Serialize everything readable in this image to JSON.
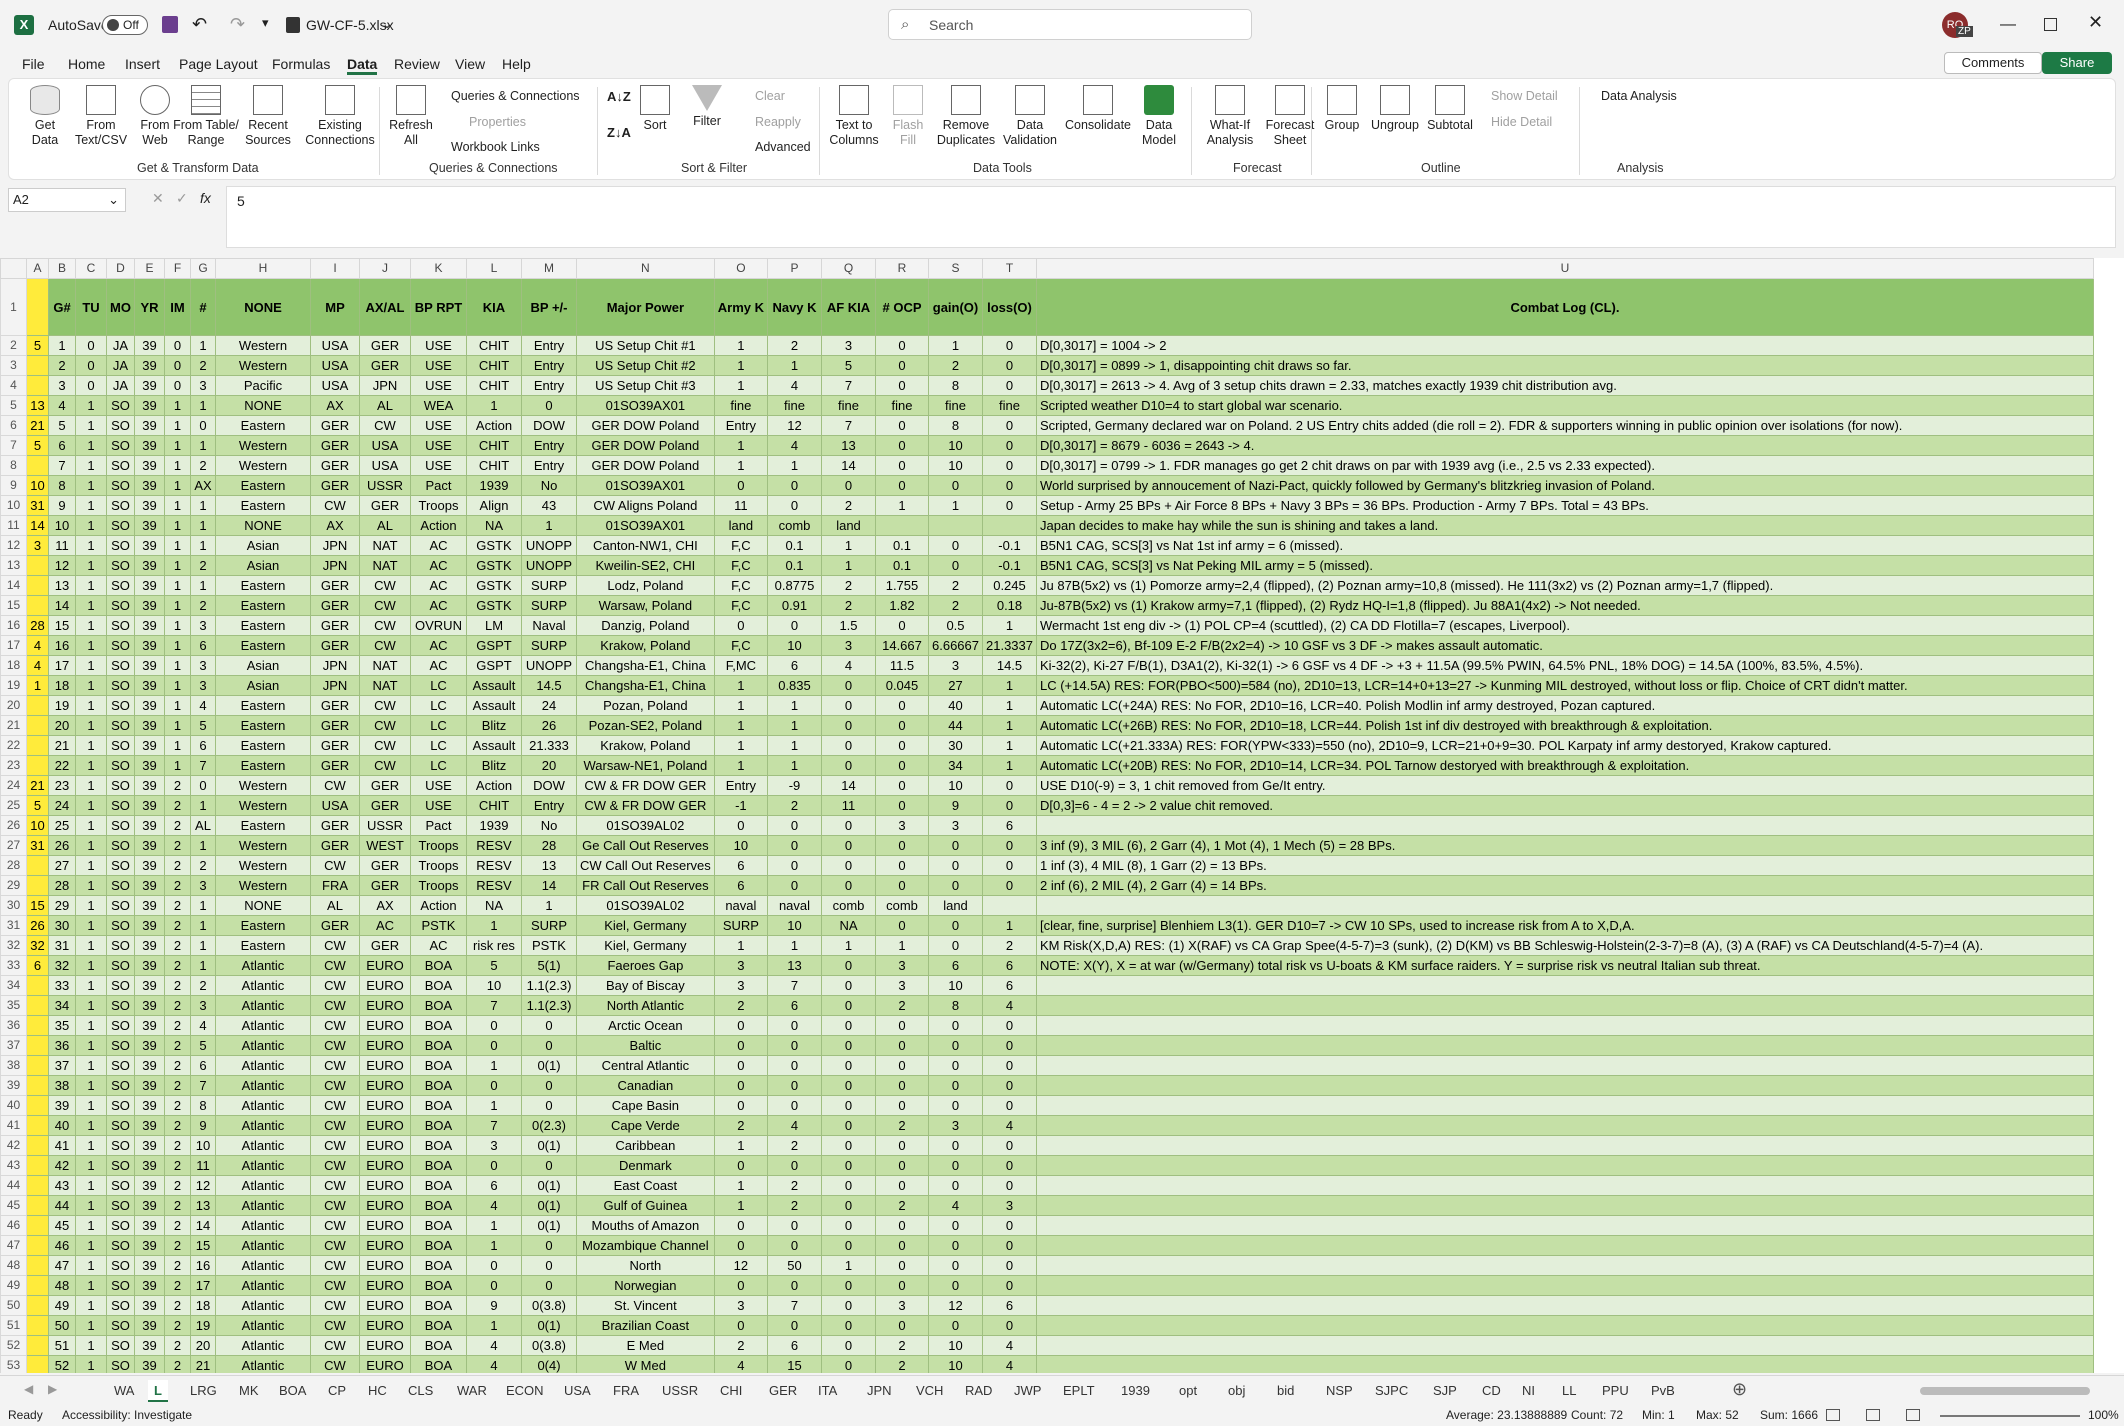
{
  "app": {
    "autosave_label": "AutoSave",
    "autosave_state": "Off",
    "file_name": "GW-CF-5.xlsx",
    "search_placeholder": "Search",
    "user_initials": "RO",
    "keytip_zp": "ZP"
  },
  "menu": [
    "File",
    "Home",
    "Insert",
    "Page Layout",
    "Formulas",
    "Data",
    "Review",
    "View",
    "Help"
  ],
  "comments_label": "Comments",
  "share_label": "Share",
  "ribbon": {
    "get_transform": {
      "group": "Get & Transform Data",
      "buttons": [
        "Get\nData",
        "From\nText/CSV",
        "From\nWeb",
        "From Table/\nRange",
        "Recent\nSources",
        "Existing\nConnections"
      ]
    },
    "queries": {
      "group": "Queries & Connections",
      "refresh": "Refresh\nAll",
      "items": [
        "Queries & Connections",
        "Properties",
        "Workbook Links"
      ]
    },
    "sort_filter": {
      "group": "Sort & Filter",
      "sort": "Sort",
      "filter": "Filter",
      "clear": "Clear",
      "reapply": "Reapply",
      "advanced": "Advanced"
    },
    "data_tools": {
      "group": "Data Tools",
      "buttons": [
        "Text to\nColumns",
        "Flash\nFill",
        "Remove\nDuplicates",
        "Data\nValidation",
        "Consolidate",
        "Data\nModel"
      ]
    },
    "forecast": {
      "group": "Forecast",
      "buttons": [
        "What-If\nAnalysis",
        "Forecast\nSheet"
      ]
    },
    "outline": {
      "group": "Outline",
      "buttons": [
        "Group",
        "Ungroup",
        "Subtotal"
      ],
      "show": "Show Detail",
      "hide": "Hide Detail"
    },
    "analysis": {
      "group": "Analysis",
      "data_analysis": "Data Analysis"
    }
  },
  "formula": {
    "namebox": "A2",
    "fx": "fx",
    "value": "5"
  },
  "columns": [
    "A",
    "B",
    "C",
    "D",
    "E",
    "F",
    "G",
    "H",
    "I",
    "J",
    "K",
    "L",
    "M",
    "N",
    "O",
    "P",
    "Q",
    "R",
    "S",
    "T",
    "U"
  ],
  "header_row": [
    "",
    "G#",
    "TU",
    "MO",
    "YR",
    "IM",
    "#",
    "NONE",
    "MP",
    "AX/AL",
    "BP RPT",
    "KIA",
    "BP +/-",
    "Major Power",
    "Army K",
    "Navy K",
    "AF KIA",
    "# OCP",
    "gain(O)",
    "loss(O)",
    "Combat Log (CL)."
  ],
  "rows": [
    [
      "5",
      "1",
      "0",
      "JA",
      "39",
      "0",
      "1",
      "Western",
      "USA",
      "GER",
      "USE",
      "CHIT",
      "Entry",
      "US Setup Chit #1",
      "1",
      "2",
      "3",
      "0",
      "1",
      "0",
      "D[0,3017] = 1004 -> 2"
    ],
    [
      "",
      "2",
      "0",
      "JA",
      "39",
      "0",
      "2",
      "Western",
      "USA",
      "GER",
      "USE",
      "CHIT",
      "Entry",
      "US Setup Chit #2",
      "1",
      "1",
      "5",
      "0",
      "2",
      "0",
      "D[0,3017] = 0899 -> 1, disappointing chit draws so far."
    ],
    [
      "",
      "3",
      "0",
      "JA",
      "39",
      "0",
      "3",
      "Pacific",
      "USA",
      "JPN",
      "USE",
      "CHIT",
      "Entry",
      "US Setup Chit #3",
      "1",
      "4",
      "7",
      "0",
      "8",
      "0",
      "D[0,3017] = 2613 -> 4.  Avg of 3 setup chits drawn = 2.33, matches exactly 1939 chit distribution avg."
    ],
    [
      "13",
      "4",
      "1",
      "SO",
      "39",
      "1",
      "1",
      "NONE",
      "AX",
      "AL",
      "WEA",
      "1",
      "0",
      "01SO39AX01",
      "fine",
      "fine",
      "fine",
      "fine",
      "fine",
      "fine",
      "Scripted weather D10=4 to start global war scenario."
    ],
    [
      "21",
      "5",
      "1",
      "SO",
      "39",
      "1",
      "0",
      "Eastern",
      "GER",
      "CW",
      "USE",
      "Action",
      "DOW",
      "GER DOW Poland",
      "Entry",
      "12",
      "7",
      "0",
      "8",
      "0",
      "Scripted, Germany declared war on Poland.  2 US Entry chits added (die roll = 2).  FDR & supporters winning in public opinion over isolations (for now)."
    ],
    [
      "5",
      "6",
      "1",
      "SO",
      "39",
      "1",
      "1",
      "Western",
      "GER",
      "USA",
      "USE",
      "CHIT",
      "Entry",
      "GER DOW Poland",
      "1",
      "4",
      "13",
      "0",
      "10",
      "0",
      "D[0,3017] = 8679 - 6036 = 2643 -> 4."
    ],
    [
      "",
      "7",
      "1",
      "SO",
      "39",
      "1",
      "2",
      "Western",
      "GER",
      "USA",
      "USE",
      "CHIT",
      "Entry",
      "GER DOW Poland",
      "1",
      "1",
      "14",
      "0",
      "10",
      "0",
      "D[0,3017] = 0799 -> 1.  FDR manages go get 2 chit draws on par with 1939 avg (i.e., 2.5 vs 2.33 expected)."
    ],
    [
      "10",
      "8",
      "1",
      "SO",
      "39",
      "1",
      "AX",
      "Eastern",
      "GER",
      "USSR",
      "Pact",
      "1939",
      "No",
      "01SO39AX01",
      "0",
      "0",
      "0",
      "0",
      "0",
      "0",
      "World surprised by annoucement of Nazi-Pact, quickly followed by Germany's blitzkrieg invasion of Poland."
    ],
    [
      "31",
      "9",
      "1",
      "SO",
      "39",
      "1",
      "1",
      "Eastern",
      "CW",
      "GER",
      "Troops",
      "Align",
      "43",
      "CW Aligns Poland",
      "11",
      "0",
      "2",
      "1",
      "1",
      "0",
      "Setup - Army 25 BPs + Air Force 8 BPs + Navy 3 BPs = 36 BPs.  Production - Army 7 BPs.  Total = 43 BPs."
    ],
    [
      "14",
      "10",
      "1",
      "SO",
      "39",
      "1",
      "1",
      "NONE",
      "AX",
      "AL",
      "Action",
      "NA",
      "1",
      "01SO39AX01",
      "land",
      "comb",
      "land",
      "",
      "",
      "",
      "Japan decides to make hay while the sun is shining and takes a land."
    ],
    [
      "3",
      "11",
      "1",
      "SO",
      "39",
      "1",
      "1",
      "Asian",
      "JPN",
      "NAT",
      "AC",
      "GSTK",
      "UNOPP",
      "Canton-NW1, CHI",
      "F,C",
      "0.1",
      "1",
      "0.1",
      "0",
      "-0.1",
      "B5N1 CAG, SCS[3] vs Nat 1st inf army = 6 (missed)."
    ],
    [
      "",
      "12",
      "1",
      "SO",
      "39",
      "1",
      "2",
      "Asian",
      "JPN",
      "NAT",
      "AC",
      "GSTK",
      "UNOPP",
      "Kweilin-SE2, CHI",
      "F,C",
      "0.1",
      "1",
      "0.1",
      "0",
      "-0.1",
      "B5N1 CAG, SCS[3] vs Nat Peking MIL army = 5 (missed)."
    ],
    [
      "",
      "13",
      "1",
      "SO",
      "39",
      "1",
      "1",
      "Eastern",
      "GER",
      "CW",
      "AC",
      "GSTK",
      "SURP",
      "Lodz, Poland",
      "F,C",
      "0.8775",
      "2",
      "1.755",
      "2",
      "0.245",
      "Ju 87B(5x2) vs (1) Pomorze army=2,4 (flipped), (2) Poznan army=10,8 (missed).  He 111(3x2) vs (2) Poznan army=1,7 (flipped)."
    ],
    [
      "",
      "14",
      "1",
      "SO",
      "39",
      "1",
      "2",
      "Eastern",
      "GER",
      "CW",
      "AC",
      "GSTK",
      "SURP",
      "Warsaw, Poland",
      "F,C",
      "0.91",
      "2",
      "1.82",
      "2",
      "0.18",
      "Ju-87B(5x2) vs (1) Krakow army=7,1 (flipped), (2) Rydz HQ-I=1,8 (flipped).  Ju 88A1(4x2) -> Not needed."
    ],
    [
      "28",
      "15",
      "1",
      "SO",
      "39",
      "1",
      "3",
      "Eastern",
      "GER",
      "CW",
      "OVRUN",
      "LM",
      "Naval",
      "Danzig, Poland",
      "0",
      "0",
      "1.5",
      "0",
      "0.5",
      "1",
      "Wermacht 1st eng div -> (1) POL CP=4 (scuttled), (2) CA DD Flotilla=7 (escapes, Liverpool)."
    ],
    [
      "4",
      "16",
      "1",
      "SO",
      "39",
      "1",
      "6",
      "Eastern",
      "GER",
      "CW",
      "AC",
      "GSPT",
      "SURP",
      "Krakow, Poland",
      "F,C",
      "10",
      "3",
      "14.667",
      "6.66667",
      "21.3337",
      "Do 17Z(3x2=6), Bf-109 E-2 F/B(2x2=4) -> 10 GSF vs 3 DF -> makes assault automatic."
    ],
    [
      "4",
      "17",
      "1",
      "SO",
      "39",
      "1",
      "3",
      "Asian",
      "JPN",
      "NAT",
      "AC",
      "GSPT",
      "UNOPP",
      "Changsha-E1, China",
      "F,MC",
      "6",
      "4",
      "11.5",
      "3",
      "14.5",
      "Ki-32(2), Ki-27 F/B(1), D3A1(2), Ki-32(1) -> 6 GSF vs 4 DF -> +3 + 11.5A (99.5% PWIN, 64.5% PNL, 18% DOG) = 14.5A (100%, 83.5%, 4.5%)."
    ],
    [
      "1",
      "18",
      "1",
      "SO",
      "39",
      "1",
      "3",
      "Asian",
      "JPN",
      "NAT",
      "LC",
      "Assault",
      "14.5",
      "Changsha-E1, China",
      "1",
      "0.835",
      "0",
      "0.045",
      "27",
      "1",
      "LC (+14.5A) RES:  FOR(PBO<500)=584 (no), 2D10=13, LCR=14+0+13=27 -> Kunming MIL destroyed, without loss or flip.  Choice of CRT didn't matter."
    ],
    [
      "",
      "19",
      "1",
      "SO",
      "39",
      "1",
      "4",
      "Eastern",
      "GER",
      "CW",
      "LC",
      "Assault",
      "24",
      "Pozan, Poland",
      "1",
      "1",
      "0",
      "0",
      "40",
      "1",
      "Automatic LC(+24A) RES:  No FOR, 2D10=16, LCR=40.  Polish Modlin inf army destroyed, Pozan captured."
    ],
    [
      "",
      "20",
      "1",
      "SO",
      "39",
      "1",
      "5",
      "Eastern",
      "GER",
      "CW",
      "LC",
      "Blitz",
      "26",
      "Pozan-SE2, Poland",
      "1",
      "1",
      "0",
      "0",
      "44",
      "1",
      "Automatic LC(+26B) RES:  No FOR, 2D10=18, LCR=44.  Polish 1st inf div destroyed with breakthrough & exploitation."
    ],
    [
      "",
      "21",
      "1",
      "SO",
      "39",
      "1",
      "6",
      "Eastern",
      "GER",
      "CW",
      "LC",
      "Assault",
      "21.333",
      "Krakow, Poland",
      "1",
      "1",
      "0",
      "0",
      "30",
      "1",
      "Automatic LC(+21.333A) RES:  FOR(YPW<333)=550 (no), 2D10=9, LCR=21+0+9=30.  POL Karpaty inf army destoryed, Krakow captured."
    ],
    [
      "",
      "22",
      "1",
      "SO",
      "39",
      "1",
      "7",
      "Eastern",
      "GER",
      "CW",
      "LC",
      "Blitz",
      "20",
      "Warsaw-NE1, Poland",
      "1",
      "1",
      "0",
      "0",
      "34",
      "1",
      "Automatic LC(+20B) RES:  No FOR, 2D10=14, LCR=34.  POL Tarnow destoryed with breakthrough & exploitation."
    ],
    [
      "21",
      "23",
      "1",
      "SO",
      "39",
      "2",
      "0",
      "Western",
      "CW",
      "GER",
      "USE",
      "Action",
      "DOW",
      "CW & FR DOW GER",
      "Entry",
      "-9",
      "14",
      "0",
      "10",
      "0",
      "USE D10(-9) = 3, 1 chit removed from Ge/It entry."
    ],
    [
      "5",
      "24",
      "1",
      "SO",
      "39",
      "2",
      "1",
      "Western",
      "USA",
      "GER",
      "USE",
      "CHIT",
      "Entry",
      "CW & FR DOW GER",
      "-1",
      "2",
      "11",
      "0",
      "9",
      "0",
      "D[0,3]=6 - 4 = 2 -> 2 value chit removed."
    ],
    [
      "10",
      "25",
      "1",
      "SO",
      "39",
      "2",
      "AL",
      "Eastern",
      "GER",
      "USSR",
      "Pact",
      "1939",
      "No",
      "01SO39AL02",
      "0",
      "0",
      "0",
      "3",
      "3",
      "6",
      ""
    ],
    [
      "31",
      "26",
      "1",
      "SO",
      "39",
      "2",
      "1",
      "Western",
      "GER",
      "WEST",
      "Troops",
      "RESV",
      "28",
      "Ge Call Out Reserves",
      "10",
      "0",
      "0",
      "0",
      "0",
      "0",
      "3 inf (9), 3 MIL (6), 2 Garr (4), 1 Mot (4), 1 Mech (5) = 28 BPs."
    ],
    [
      "",
      "27",
      "1",
      "SO",
      "39",
      "2",
      "2",
      "Western",
      "CW",
      "GER",
      "Troops",
      "RESV",
      "13",
      "CW Call Out Reserves",
      "6",
      "0",
      "0",
      "0",
      "0",
      "0",
      "1 inf (3), 4 MIL (8), 1 Garr (2) = 13 BPs."
    ],
    [
      "",
      "28",
      "1",
      "SO",
      "39",
      "2",
      "3",
      "Western",
      "FRA",
      "GER",
      "Troops",
      "RESV",
      "14",
      "FR Call Out Reserves",
      "6",
      "0",
      "0",
      "0",
      "0",
      "0",
      "2 inf (6), 2 MIL (4), 2 Garr (4) = 14 BPs."
    ],
    [
      "15",
      "29",
      "1",
      "SO",
      "39",
      "2",
      "1",
      "NONE",
      "AL",
      "AX",
      "Action",
      "NA",
      "1",
      "01SO39AL02",
      "naval",
      "naval",
      "comb",
      "comb",
      "land",
      "",
      ""
    ],
    [
      "26",
      "30",
      "1",
      "SO",
      "39",
      "2",
      "1",
      "Eastern",
      "GER",
      "AC",
      "PSTK",
      "1",
      "SURP",
      "Kiel, Germany",
      "SURP",
      "10",
      "NA",
      "0",
      "0",
      "1",
      "[clear, fine, surprise]  Blenhiem L3(1).  GER D10=7 -> CW 10 SPs, used to increase risk from A to X,D,A."
    ],
    [
      "32",
      "31",
      "1",
      "SO",
      "39",
      "2",
      "1",
      "Eastern",
      "CW",
      "GER",
      "AC",
      "risk res",
      "PSTK",
      "Kiel, Germany",
      "1",
      "1",
      "1",
      "1",
      "0",
      "2",
      "KM Risk(X,D,A) RES: (1) X(RAF) vs CA Grap Spee(4-5-7)=3 (sunk), (2) D(KM) vs BB Schleswig-Holstein(2-3-7)=8 (A), (3) A (RAF) vs CA Deutschland(4-5-7)=4 (A)."
    ],
    [
      "6",
      "32",
      "1",
      "SO",
      "39",
      "2",
      "1",
      "Atlantic",
      "CW",
      "EURO",
      "BOA",
      "5",
      "5(1)",
      "Faeroes Gap",
      "3",
      "13",
      "0",
      "3",
      "6",
      "6",
      "NOTE: X(Y), X = at war (w/Germany) total risk vs U-boats & KM surface raiders.  Y = surprise risk vs neutral Italian sub threat."
    ],
    [
      "",
      "33",
      "1",
      "SO",
      "39",
      "2",
      "2",
      "Atlantic",
      "CW",
      "EURO",
      "BOA",
      "10",
      "1.1(2.3)",
      "Bay of Biscay",
      "3",
      "7",
      "0",
      "3",
      "10",
      "6",
      ""
    ],
    [
      "",
      "34",
      "1",
      "SO",
      "39",
      "2",
      "3",
      "Atlantic",
      "CW",
      "EURO",
      "BOA",
      "7",
      "1.1(2.3)",
      "North Atlantic",
      "2",
      "6",
      "0",
      "2",
      "8",
      "4",
      ""
    ],
    [
      "",
      "35",
      "1",
      "SO",
      "39",
      "2",
      "4",
      "Atlantic",
      "CW",
      "EURO",
      "BOA",
      "0",
      "0",
      "Arctic Ocean",
      "0",
      "0",
      "0",
      "0",
      "0",
      "0",
      ""
    ],
    [
      "",
      "36",
      "1",
      "SO",
      "39",
      "2",
      "5",
      "Atlantic",
      "CW",
      "EURO",
      "BOA",
      "0",
      "0",
      "Baltic",
      "0",
      "0",
      "0",
      "0",
      "0",
      "0",
      ""
    ],
    [
      "",
      "37",
      "1",
      "SO",
      "39",
      "2",
      "6",
      "Atlantic",
      "CW",
      "EURO",
      "BOA",
      "1",
      "0(1)",
      "Central Atlantic",
      "0",
      "0",
      "0",
      "0",
      "0",
      "0",
      ""
    ],
    [
      "",
      "38",
      "1",
      "SO",
      "39",
      "2",
      "7",
      "Atlantic",
      "CW",
      "EURO",
      "BOA",
      "0",
      "0",
      "Canadian",
      "0",
      "0",
      "0",
      "0",
      "0",
      "0",
      ""
    ],
    [
      "",
      "39",
      "1",
      "SO",
      "39",
      "2",
      "8",
      "Atlantic",
      "CW",
      "EURO",
      "BOA",
      "1",
      "0",
      "Cape Basin",
      "0",
      "0",
      "0",
      "0",
      "0",
      "0",
      ""
    ],
    [
      "",
      "40",
      "1",
      "SO",
      "39",
      "2",
      "9",
      "Atlantic",
      "CW",
      "EURO",
      "BOA",
      "7",
      "0(2.3)",
      "Cape Verde",
      "2",
      "4",
      "0",
      "2",
      "3",
      "4",
      ""
    ],
    [
      "",
      "41",
      "1",
      "SO",
      "39",
      "2",
      "10",
      "Atlantic",
      "CW",
      "EURO",
      "BOA",
      "3",
      "0(1)",
      "Caribbean",
      "1",
      "2",
      "0",
      "0",
      "0",
      "0",
      ""
    ],
    [
      "",
      "42",
      "1",
      "SO",
      "39",
      "2",
      "11",
      "Atlantic",
      "CW",
      "EURO",
      "BOA",
      "0",
      "0",
      "Denmark",
      "0",
      "0",
      "0",
      "0",
      "0",
      "0",
      ""
    ],
    [
      "",
      "43",
      "1",
      "SO",
      "39",
      "2",
      "12",
      "Atlantic",
      "CW",
      "EURO",
      "BOA",
      "6",
      "0(1)",
      "East Coast",
      "1",
      "2",
      "0",
      "0",
      "0",
      "0",
      ""
    ],
    [
      "",
      "44",
      "1",
      "SO",
      "39",
      "2",
      "13",
      "Atlantic",
      "CW",
      "EURO",
      "BOA",
      "4",
      "0(1)",
      "Gulf of Guinea",
      "1",
      "2",
      "0",
      "2",
      "4",
      "3",
      ""
    ],
    [
      "",
      "45",
      "1",
      "SO",
      "39",
      "2",
      "14",
      "Atlantic",
      "CW",
      "EURO",
      "BOA",
      "1",
      "0(1)",
      "Mouths of Amazon",
      "0",
      "0",
      "0",
      "0",
      "0",
      "0",
      ""
    ],
    [
      "",
      "46",
      "1",
      "SO",
      "39",
      "2",
      "15",
      "Atlantic",
      "CW",
      "EURO",
      "BOA",
      "1",
      "0",
      "Mozambique Channel",
      "0",
      "0",
      "0",
      "0",
      "0",
      "0",
      ""
    ],
    [
      "",
      "47",
      "1",
      "SO",
      "39",
      "2",
      "16",
      "Atlantic",
      "CW",
      "EURO",
      "BOA",
      "0",
      "0",
      "North",
      "12",
      "50",
      "1",
      "0",
      "0",
      "0",
      ""
    ],
    [
      "",
      "48",
      "1",
      "SO",
      "39",
      "2",
      "17",
      "Atlantic",
      "CW",
      "EURO",
      "BOA",
      "0",
      "0",
      "Norwegian",
      "0",
      "0",
      "0",
      "0",
      "0",
      "0",
      ""
    ],
    [
      "",
      "49",
      "1",
      "SO",
      "39",
      "2",
      "18",
      "Atlantic",
      "CW",
      "EURO",
      "BOA",
      "9",
      "0(3.8)",
      "St. Vincent",
      "3",
      "7",
      "0",
      "3",
      "12",
      "6",
      ""
    ],
    [
      "",
      "50",
      "1",
      "SO",
      "39",
      "2",
      "19",
      "Atlantic",
      "CW",
      "EURO",
      "BOA",
      "1",
      "0(1)",
      "Brazilian Coast",
      "0",
      "0",
      "0",
      "0",
      "0",
      "0",
      ""
    ],
    [
      "",
      "51",
      "1",
      "SO",
      "39",
      "2",
      "20",
      "Atlantic",
      "CW",
      "EURO",
      "BOA",
      "4",
      "0(3.8)",
      "E Med",
      "2",
      "6",
      "0",
      "2",
      "10",
      "4",
      ""
    ],
    [
      "",
      "52",
      "1",
      "SO",
      "39",
      "2",
      "21",
      "Atlantic",
      "CW",
      "EURO",
      "BOA",
      "4",
      "0(4)",
      "W Med",
      "4",
      "15",
      "0",
      "2",
      "10",
      "4",
      ""
    ]
  ],
  "sheets": [
    "WA",
    "L",
    "LRG",
    "MK",
    "BOA",
    "CP",
    "HC",
    "CLS",
    "WAR",
    "ECON",
    "USA",
    "FRA",
    "USSR",
    "CHI",
    "GER",
    "ITA",
    "JPN",
    "VCH",
    "RAD",
    "JWP",
    "EPLT",
    "1939",
    "opt",
    "obj",
    "bid",
    "NSP",
    "SJPC",
    "SJP",
    "CD",
    "NI",
    "LL",
    "PPU",
    "PvB"
  ],
  "active_sheet": "L",
  "status": {
    "ready": "Ready",
    "accessibility": "Accessibility: Investigate",
    "average": "Average: 23.13888889",
    "count": "Count: 72",
    "min": "Min: 1",
    "max": "Max: 52",
    "sum": "Sum: 1666",
    "zoom": "100%"
  }
}
